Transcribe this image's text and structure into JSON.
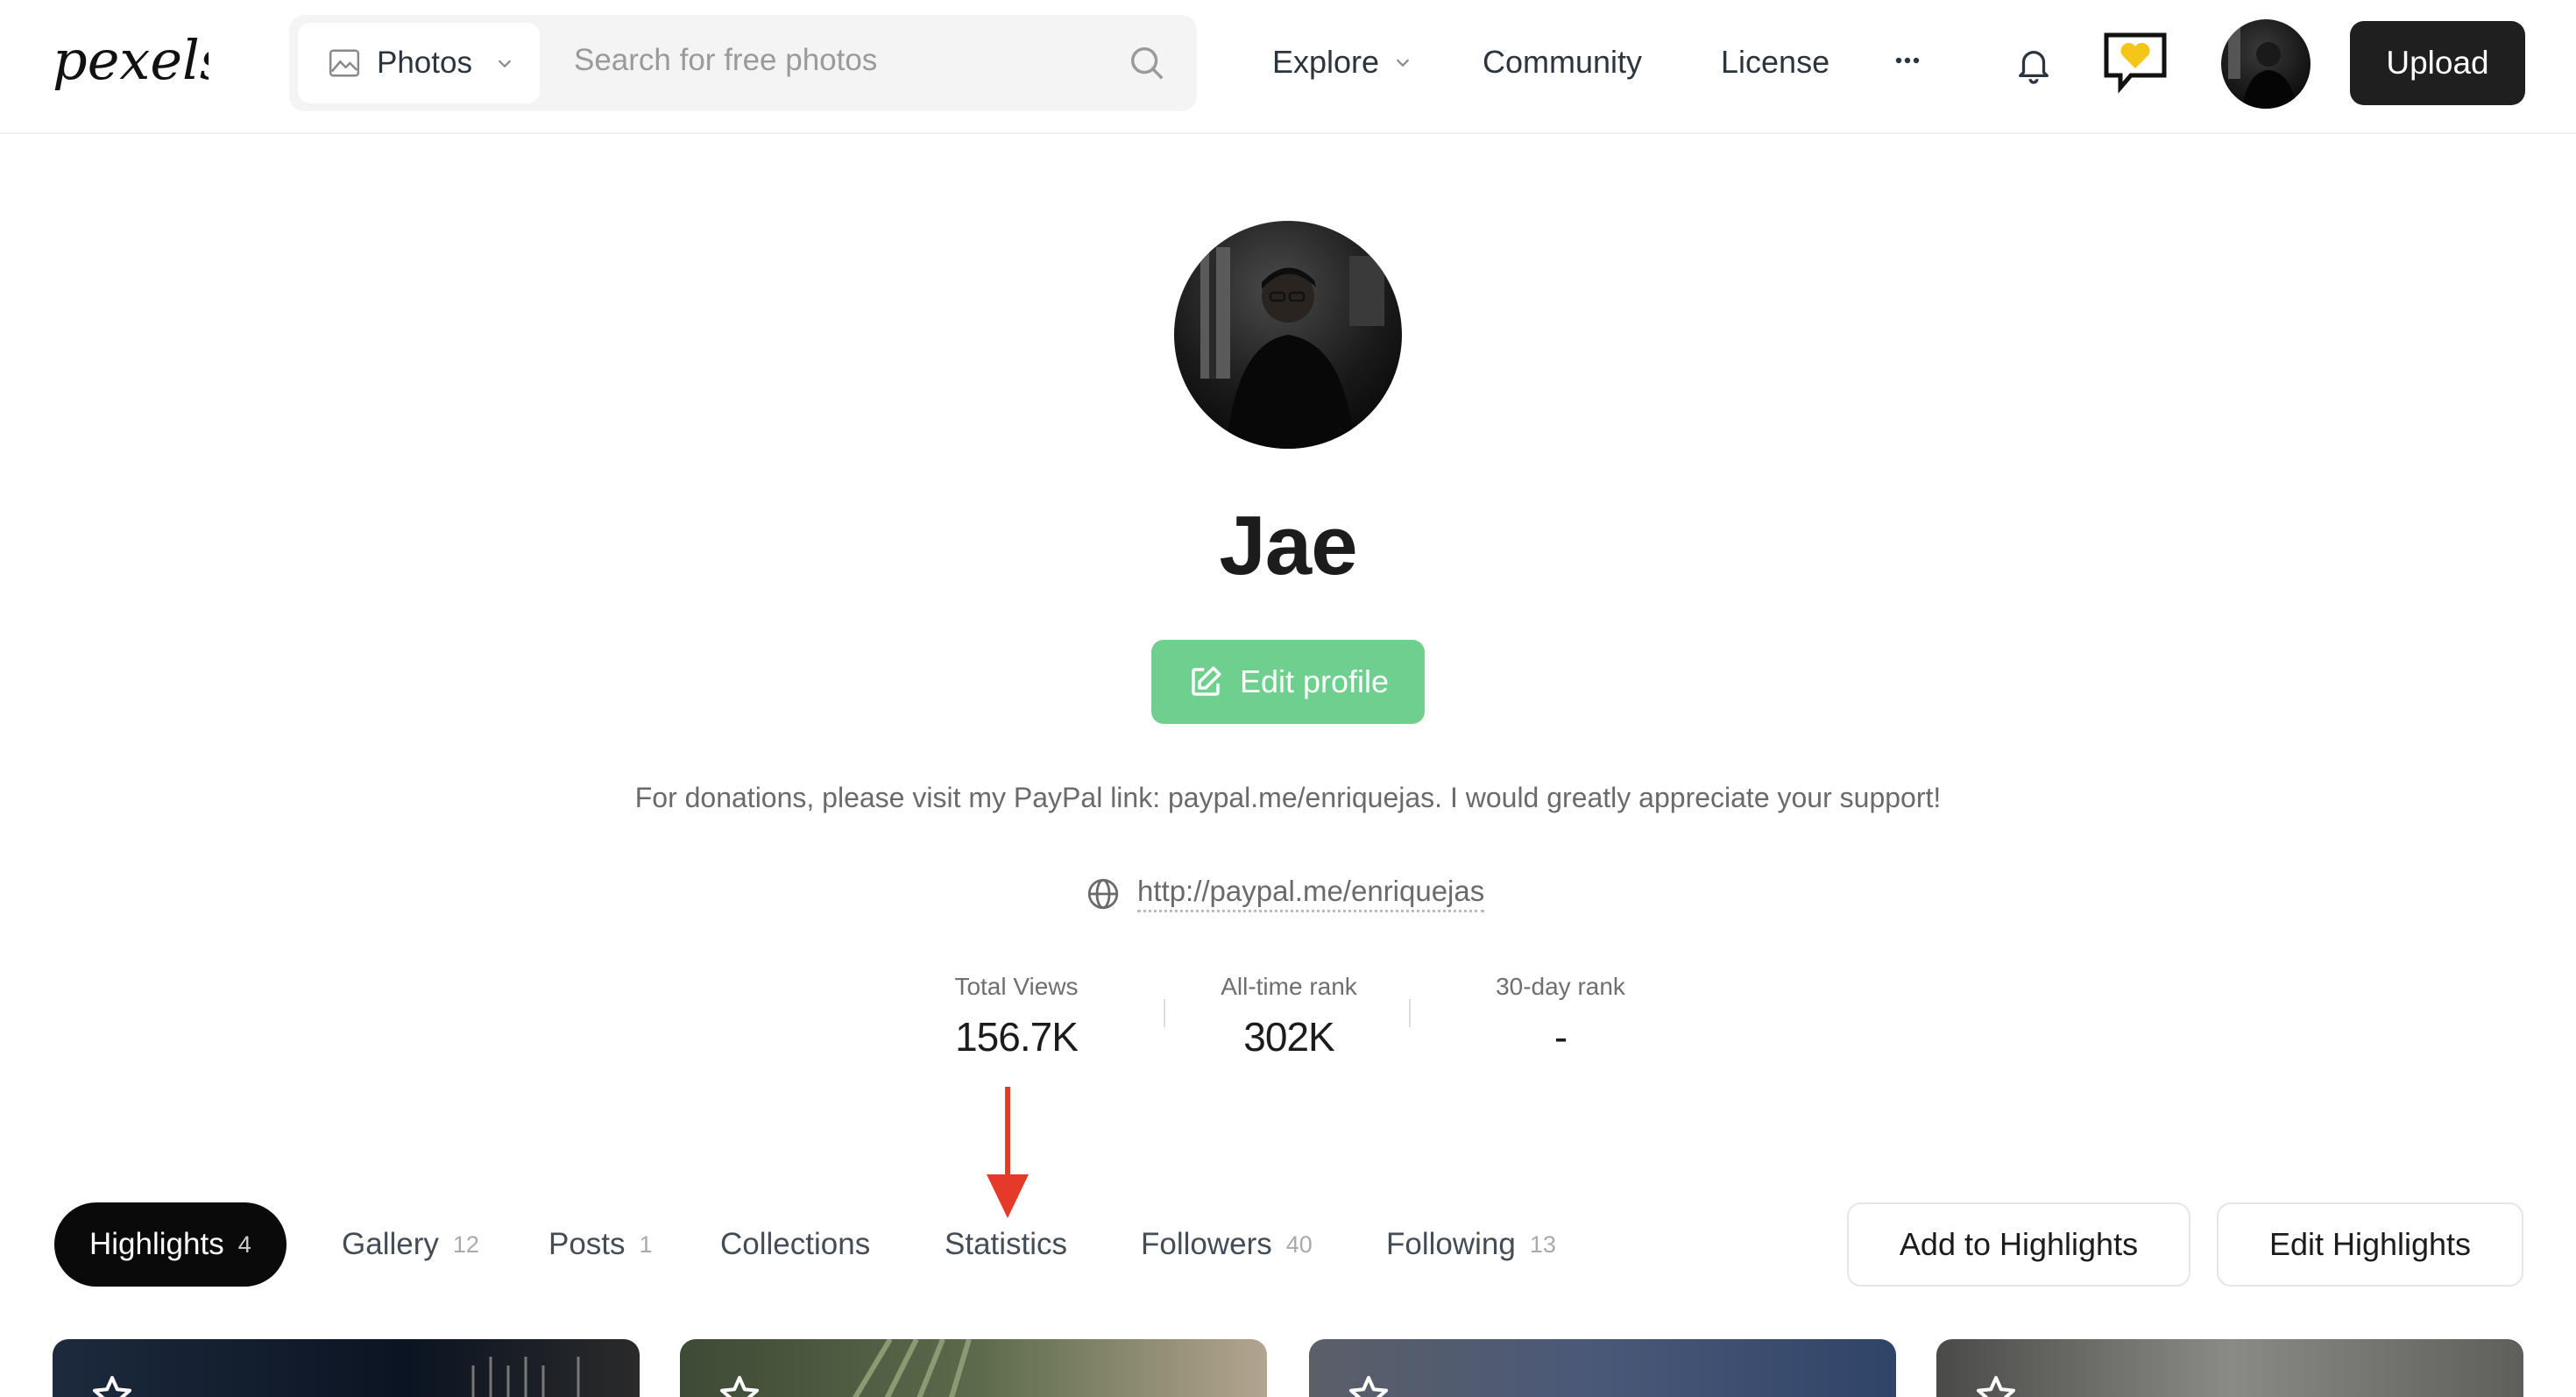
{
  "header": {
    "logo_text": "pexels",
    "search_type": "Photos",
    "search_placeholder": "Search for free photos",
    "nav": {
      "explore": "Explore",
      "community": "Community",
      "license": "License"
    },
    "upload_label": "Upload"
  },
  "profile": {
    "name": "Jae",
    "edit_label": "Edit profile",
    "bio": "For donations, please visit my PayPal link: paypal.me/enriquejas. I would greatly appreciate your support!",
    "website": "http://paypal.me/enriquejas",
    "stats": [
      {
        "label": "Total Views",
        "value": "156.7K"
      },
      {
        "label": "All-time rank",
        "value": "302K"
      },
      {
        "label": "30-day rank",
        "value": "-"
      }
    ]
  },
  "tabs": [
    {
      "label": "Highlights",
      "count": "4"
    },
    {
      "label": "Gallery",
      "count": "12"
    },
    {
      "label": "Posts",
      "count": "1"
    },
    {
      "label": "Collections",
      "count": ""
    },
    {
      "label": "Statistics",
      "count": ""
    },
    {
      "label": "Followers",
      "count": "40"
    },
    {
      "label": "Following",
      "count": "13"
    }
  ],
  "actions": {
    "add_highlights": "Add to Highlights",
    "edit_highlights": "Edit Highlights"
  },
  "colors": {
    "accent_green": "#6fcf8e",
    "annotation_red": "#e53a2a",
    "upload_bg": "#1f1f1f"
  },
  "icons": [
    "image-icon",
    "chevron-down-icon",
    "search-icon",
    "more-icon",
    "bell-icon",
    "heart-badge-icon",
    "edit-icon",
    "globe-icon",
    "star-icon"
  ]
}
